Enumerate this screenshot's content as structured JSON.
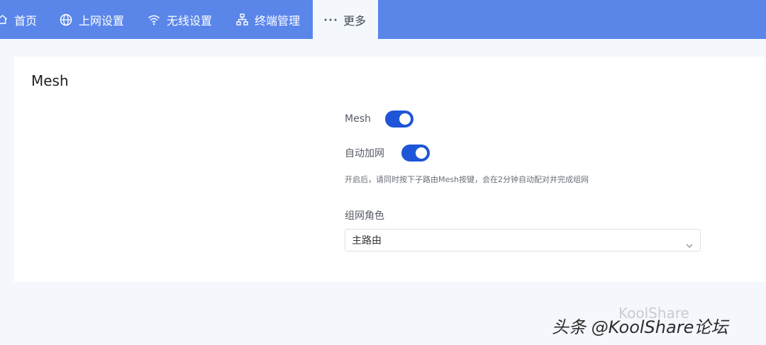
{
  "nav": {
    "items": [
      {
        "label": "首页",
        "icon": "home-icon"
      },
      {
        "label": "上网设置",
        "icon": "globe-icon"
      },
      {
        "label": "无线设置",
        "icon": "wifi-icon"
      },
      {
        "label": "终端管理",
        "icon": "network-icon"
      },
      {
        "label": "更多",
        "icon": "more-icon"
      }
    ],
    "active_index": 4
  },
  "card": {
    "title": "Mesh",
    "mesh": {
      "label": "Mesh",
      "enabled": true
    },
    "auto_join": {
      "label": "自动加网",
      "enabled": true
    },
    "hint": "开启后，请同时按下子路由Mesh按键，会在2分钟自动配对并完成组网",
    "role": {
      "label": "组网角色",
      "value": "主路由"
    }
  },
  "watermark": {
    "text": "头条 @KoolShare论坛",
    "faint_text": "KoolShare"
  },
  "colors": {
    "nav_bg": "#5a86ea",
    "toggle_on": "#1f56d7",
    "page_bg": "#f4f7fc"
  }
}
